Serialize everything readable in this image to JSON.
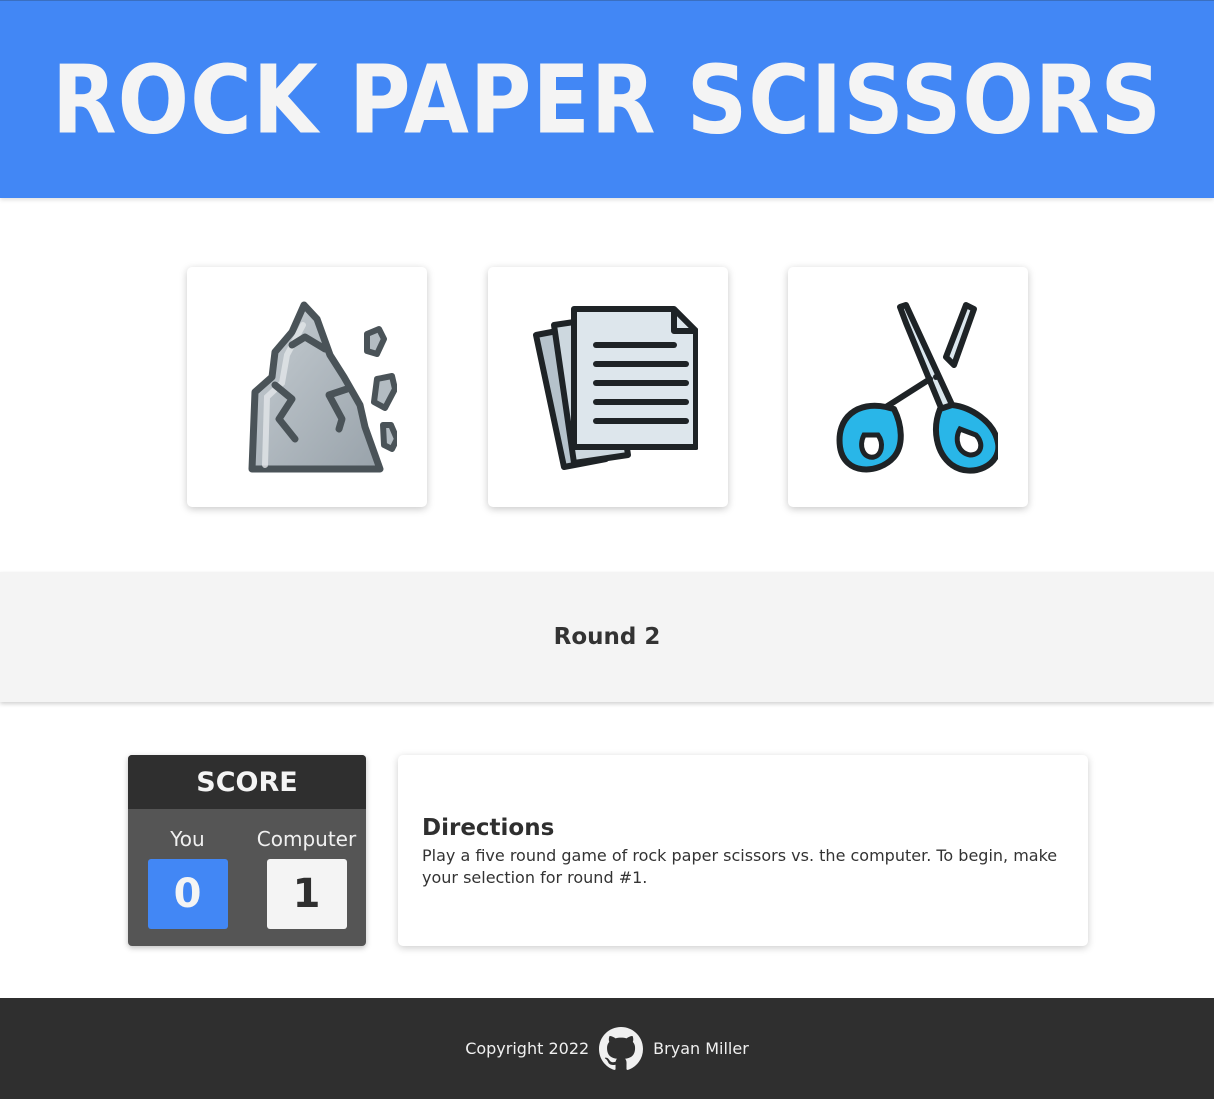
{
  "header": {
    "title": "ROCK PAPER SCISSORS"
  },
  "choices": [
    {
      "label": "rock",
      "icon": "rock-icon"
    },
    {
      "label": "paper",
      "icon": "paper-icon"
    },
    {
      "label": "scissors",
      "icon": "scissors-icon"
    }
  ],
  "round": {
    "text": "Round 2"
  },
  "score": {
    "title": "SCORE",
    "player_label": "You",
    "player_value": "0",
    "computer_label": "Computer",
    "computer_value": "1"
  },
  "directions": {
    "title": "Directions",
    "text": "Play a five round game of rock paper scissors vs. the computer. To begin, make your selection for round #1."
  },
  "footer": {
    "copyright": "Copyright 2022",
    "author": "Bryan Miller",
    "icon": "github-icon"
  },
  "colors": {
    "header_bg": "#4287f5",
    "player_score_bg": "#4287f5",
    "computer_score_bg": "#f4f4f4",
    "footer_bg": "#2f2f2f",
    "scissors_handle": "#29b6e8"
  }
}
